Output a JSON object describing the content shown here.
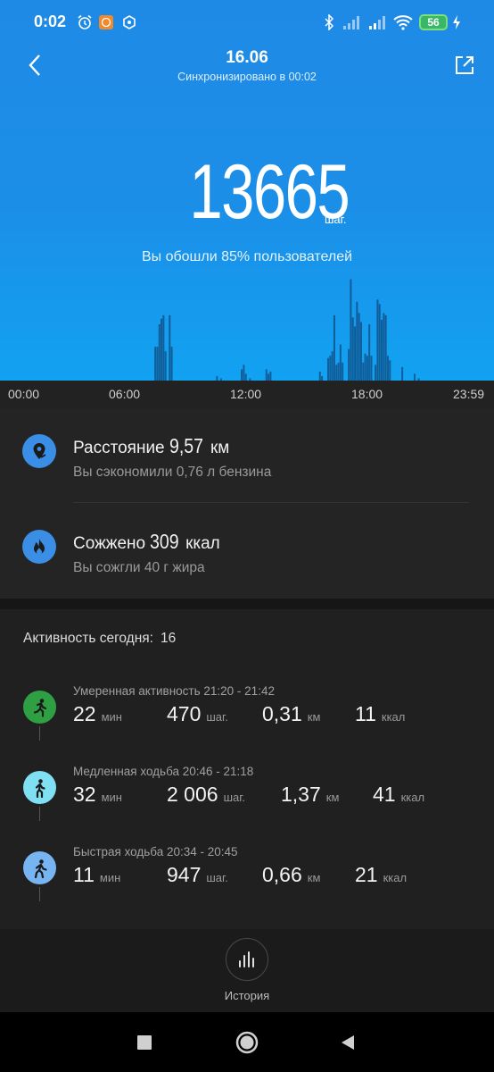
{
  "status_bar": {
    "time": "0:02",
    "battery": "56",
    "icons": [
      "alarm-clock-icon",
      "app-notification-icon",
      "hexagon-icon",
      "bluetooth-icon",
      "signal-icon",
      "signal-icon",
      "wifi-icon",
      "battery-icon",
      "charging-icon"
    ]
  },
  "header": {
    "date": "16.06",
    "sync": "Синхронизировано в 00:02",
    "back_icon": "chevron-left-icon",
    "share_icon": "share-icon"
  },
  "summary": {
    "steps": "13665",
    "steps_unit": "шаг.",
    "comparison": "Вы обошли 85% пользователей"
  },
  "hourly_chart": {
    "time_labels": [
      "00:00",
      "06:00",
      "12:00",
      "18:00",
      "23:59"
    ]
  },
  "chart_data": {
    "type": "bar",
    "x_range": [
      0,
      1440
    ],
    "x_unit": "minutes",
    "bar_width_min": 6,
    "values": [
      [
        450,
        30
      ],
      [
        456,
        30
      ],
      [
        462,
        50
      ],
      [
        468,
        55
      ],
      [
        474,
        58
      ],
      [
        480,
        26
      ],
      [
        492,
        58
      ],
      [
        498,
        30
      ],
      [
        630,
        4
      ],
      [
        642,
        2
      ],
      [
        702,
        10
      ],
      [
        708,
        14
      ],
      [
        714,
        6
      ],
      [
        726,
        2
      ],
      [
        774,
        10
      ],
      [
        780,
        6
      ],
      [
        786,
        8
      ],
      [
        930,
        8
      ],
      [
        936,
        4
      ],
      [
        954,
        20
      ],
      [
        960,
        22
      ],
      [
        966,
        26
      ],
      [
        972,
        58
      ],
      [
        978,
        14
      ],
      [
        984,
        16
      ],
      [
        990,
        32
      ],
      [
        996,
        16
      ],
      [
        1014,
        28
      ],
      [
        1020,
        90
      ],
      [
        1026,
        56
      ],
      [
        1032,
        48
      ],
      [
        1038,
        70
      ],
      [
        1044,
        60
      ],
      [
        1050,
        52
      ],
      [
        1056,
        16
      ],
      [
        1062,
        24
      ],
      [
        1068,
        22
      ],
      [
        1074,
        50
      ],
      [
        1080,
        22
      ],
      [
        1092,
        14
      ],
      [
        1098,
        72
      ],
      [
        1104,
        68
      ],
      [
        1110,
        54
      ],
      [
        1116,
        60
      ],
      [
        1122,
        58
      ],
      [
        1128,
        22
      ],
      [
        1134,
        18
      ],
      [
        1170,
        12
      ],
      [
        1206,
        6
      ],
      [
        1218,
        2
      ]
    ]
  },
  "metrics": [
    {
      "icon": "location-pin-icon",
      "label": "Расстояние",
      "value": "9,57",
      "unit": "км",
      "sub": "Вы сэкономили 0,76 л бензина"
    },
    {
      "icon": "flame-icon",
      "label": "Сожжено",
      "value": "309",
      "unit": "ккал",
      "sub": "Вы сожгли 40 г жира"
    }
  ],
  "activity": {
    "header": "Активность сегодня:",
    "count": "16",
    "items": [
      {
        "title": "Умеренная активность 21:20 - 21:42",
        "color": "#2ea043",
        "stats": [
          {
            "value": "22",
            "unit": "мин"
          },
          {
            "value": "470",
            "unit": "шаг."
          },
          {
            "value": "0,31",
            "unit": "км"
          },
          {
            "value": "11",
            "unit": "ккал"
          }
        ]
      },
      {
        "title": "Медленная ходьба 20:46 - 21:18",
        "color": "#7ee0f2",
        "stats": [
          {
            "value": "32",
            "unit": "мин"
          },
          {
            "value": "2 006",
            "unit": "шаг."
          },
          {
            "value": "1,37",
            "unit": "км"
          },
          {
            "value": "41",
            "unit": "ккал"
          }
        ]
      },
      {
        "title": "Быстрая ходьба 20:34 - 20:45",
        "color": "#77b5f2",
        "stats": [
          {
            "value": "11",
            "unit": "мин"
          },
          {
            "value": "947",
            "unit": "шаг."
          },
          {
            "value": "0,66",
            "unit": "км"
          },
          {
            "value": "21",
            "unit": "ккал"
          }
        ]
      }
    ]
  },
  "bottom_nav": {
    "history_label": "История"
  }
}
